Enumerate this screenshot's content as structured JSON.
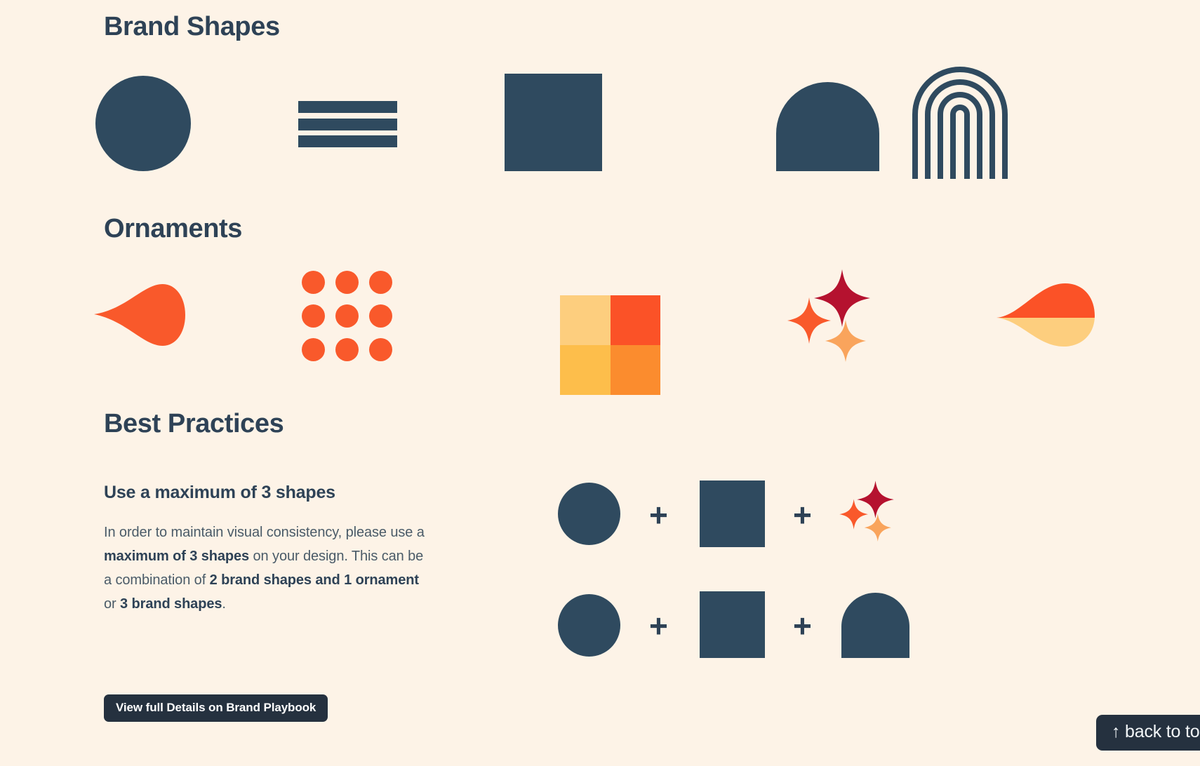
{
  "theme": {
    "background": "#FDF3E7",
    "navy": "#2F4A5F",
    "navy_text": "#2E4256",
    "body_text": "#4A5B68",
    "button_bg": "#25313F",
    "button_text": "#FFFFFF",
    "orange": "#F9592B",
    "orange_mid": "#FB8C2E",
    "orange_light": "#FDBE4B",
    "orange_pale": "#FDCE7E",
    "crimson": "#B5122F",
    "apricot": "#F9A45C"
  },
  "sections": {
    "brand_shapes": {
      "heading": "Brand Shapes",
      "items": [
        {
          "name": "circle",
          "color": "#2F4A5F"
        },
        {
          "name": "stripes",
          "color": "#2F4A5F",
          "count": 3
        },
        {
          "name": "square",
          "color": "#2F4A5F"
        },
        {
          "name": "arch",
          "color": "#2F4A5F"
        },
        {
          "name": "rainbow",
          "color": "#2F4A5F",
          "rings": 4
        }
      ]
    },
    "ornaments": {
      "heading": "Ornaments",
      "items": [
        {
          "name": "teardrop",
          "color": "#F9592B"
        },
        {
          "name": "dot-grid",
          "color": "#F9592B",
          "rows": 3,
          "cols": 3
        },
        {
          "name": "quad-square",
          "colors": [
            "#FDCE7E",
            "#FB5227",
            "#FDBE4B",
            "#FB8C2E"
          ]
        },
        {
          "name": "sparkles",
          "colors": [
            "#B5122F",
            "#F9592B",
            "#F9A45C"
          ],
          "count": 3
        },
        {
          "name": "petal",
          "colors": [
            "#FB5227",
            "#FDCE7E"
          ]
        }
      ]
    },
    "best_practices": {
      "heading": "Best Practices",
      "subheading": "Use a maximum of 3 shapes",
      "paragraph": {
        "p1": "In order to maintain visual consistency, please use a ",
        "b1": "maximum of 3 shapes",
        "p2": " on your design. This can be a combination of ",
        "b2": "2 brand shapes and 1 ornament",
        "p3": " or ",
        "b3": "3 brand shapes",
        "p4": "."
      },
      "button_label": "View full Details on Brand Playbook",
      "formulas": [
        {
          "operator": "+",
          "parts": [
            "circle",
            "square",
            "sparkles"
          ]
        },
        {
          "operator": "+",
          "parts": [
            "circle",
            "square",
            "arch"
          ]
        }
      ]
    }
  },
  "back_to_top": {
    "label": "↑ back to top ↑"
  }
}
